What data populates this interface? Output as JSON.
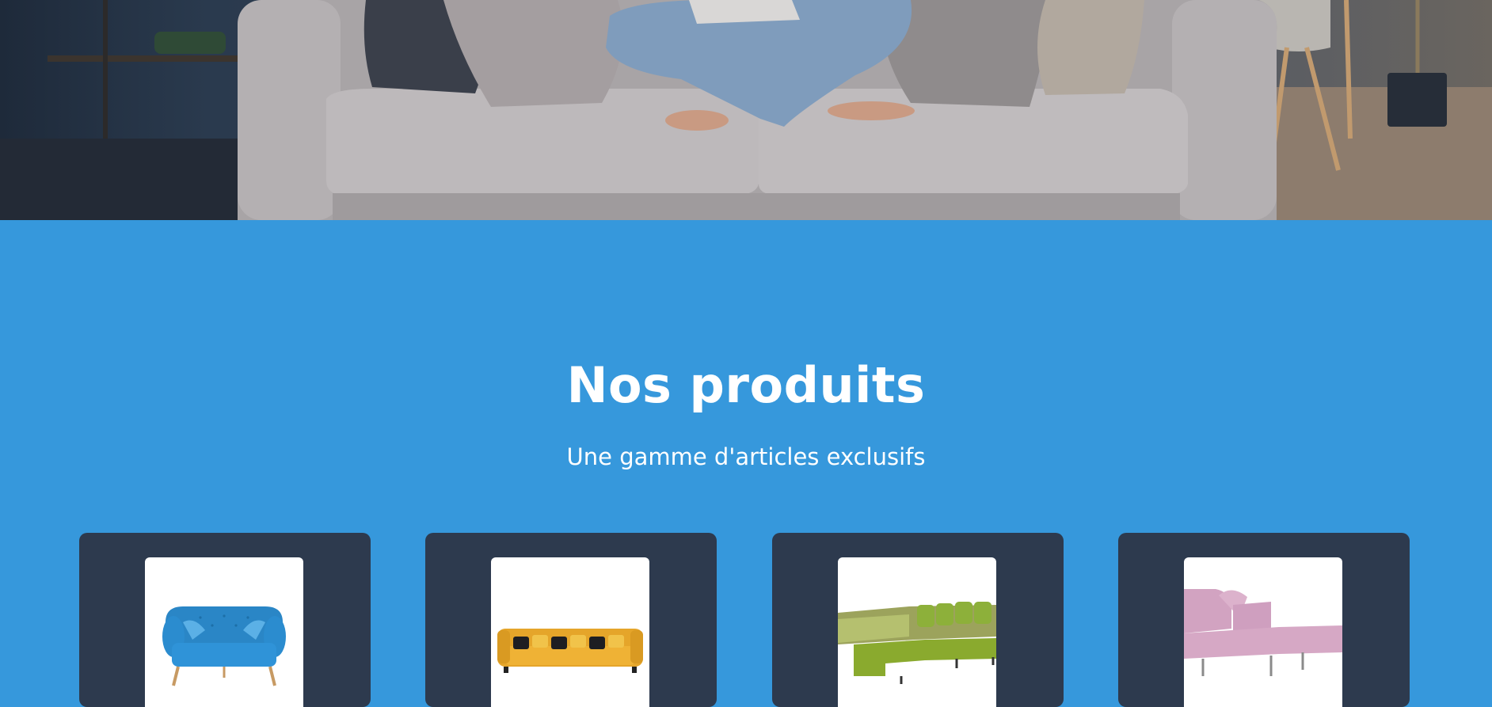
{
  "products": {
    "title": "Nos produits",
    "subtitle": "Une gamme d'articles exclusifs",
    "items": [
      {
        "image": "blue-tufted-loveseat",
        "color": "#2e8ed0"
      },
      {
        "image": "yellow-sofa-black-pillows",
        "color": "#e8a92a"
      },
      {
        "image": "green-sectional-sofa",
        "color": "#8db03a"
      },
      {
        "image": "pink-chaise-sofa",
        "color": "#d5a6c4"
      }
    ]
  },
  "colors": {
    "section_background": "#3698dc",
    "card_background": "#2d3a4e",
    "thumbnail_background": "#ffffff",
    "text": "#ffffff"
  }
}
